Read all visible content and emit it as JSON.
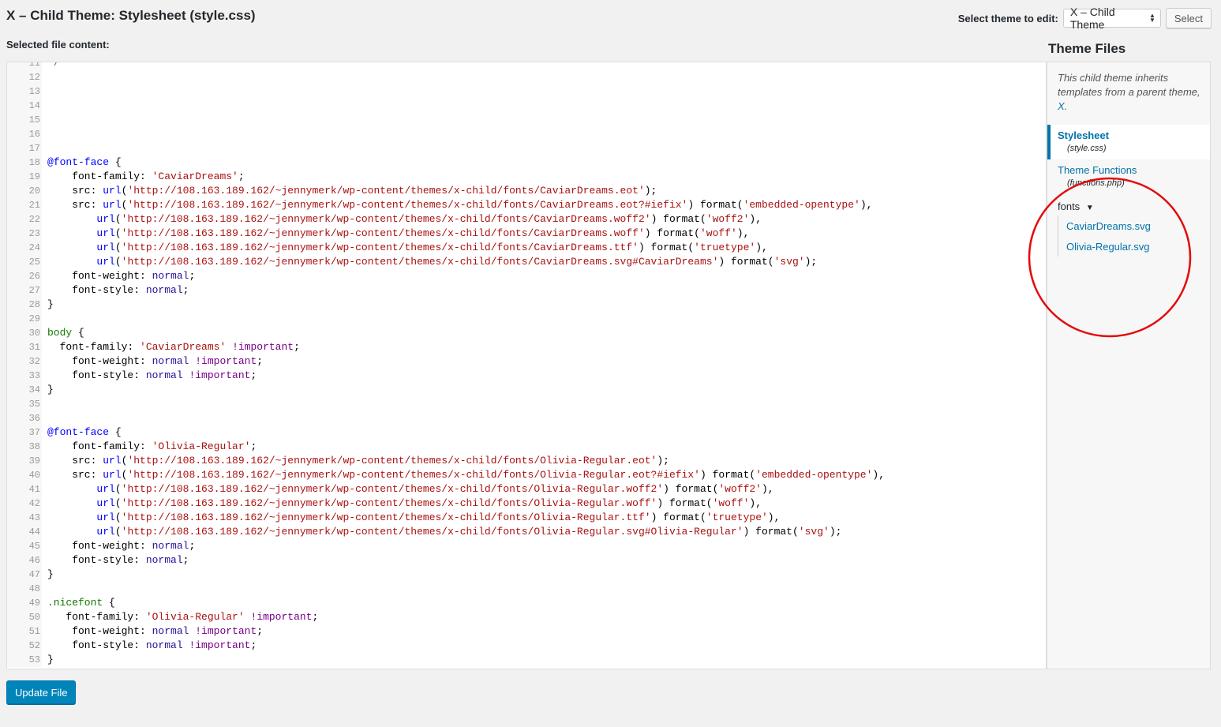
{
  "page_title": "X – Child Theme: Stylesheet (style.css)",
  "theme_selector": {
    "label": "Select theme to edit:",
    "selected": "X – Child Theme",
    "button": "Select"
  },
  "content_label": "Selected file content:",
  "editor": {
    "lines": [
      {
        "n": "11",
        "t": [
          [
            "cmt",
            "*/"
          ]
        ]
      },
      {
        "n": "12",
        "t": []
      },
      {
        "n": "13",
        "t": []
      },
      {
        "n": "14",
        "t": []
      },
      {
        "n": "15",
        "t": []
      },
      {
        "n": "16",
        "t": []
      },
      {
        "n": "17",
        "t": []
      },
      {
        "n": "18",
        "t": [
          [
            "at",
            "@font-face"
          ],
          [
            "",
            " {"
          ]
        ]
      },
      {
        "n": "19",
        "t": [
          [
            "",
            "    font-family: "
          ],
          [
            "str",
            "'CaviarDreams'"
          ],
          [
            "",
            ";"
          ]
        ]
      },
      {
        "n": "20",
        "t": [
          [
            "",
            "    src: "
          ],
          [
            "at",
            "url"
          ],
          [
            "",
            "("
          ],
          [
            "str",
            "'http://108.163.189.162/~jennymerk/wp-content/themes/x-child/fonts/CaviarDreams.eot'"
          ],
          [
            "",
            ");"
          ]
        ]
      },
      {
        "n": "21",
        "t": [
          [
            "",
            "    src: "
          ],
          [
            "at",
            "url"
          ],
          [
            "",
            "("
          ],
          [
            "str",
            "'http://108.163.189.162/~jennymerk/wp-content/themes/x-child/fonts/CaviarDreams.eot?#iefix'"
          ],
          [
            "",
            ") format("
          ],
          [
            "str",
            "'embedded-opentype'"
          ],
          [
            "",
            "),"
          ]
        ]
      },
      {
        "n": "22",
        "t": [
          [
            "",
            "        "
          ],
          [
            "at",
            "url"
          ],
          [
            "",
            "("
          ],
          [
            "str",
            "'http://108.163.189.162/~jennymerk/wp-content/themes/x-child/fonts/CaviarDreams.woff2'"
          ],
          [
            "",
            ") format("
          ],
          [
            "str",
            "'woff2'"
          ],
          [
            "",
            "),"
          ]
        ]
      },
      {
        "n": "23",
        "t": [
          [
            "",
            "        "
          ],
          [
            "at",
            "url"
          ],
          [
            "",
            "("
          ],
          [
            "str",
            "'http://108.163.189.162/~jennymerk/wp-content/themes/x-child/fonts/CaviarDreams.woff'"
          ],
          [
            "",
            ") format("
          ],
          [
            "str",
            "'woff'"
          ],
          [
            "",
            "),"
          ]
        ]
      },
      {
        "n": "24",
        "t": [
          [
            "",
            "        "
          ],
          [
            "at",
            "url"
          ],
          [
            "",
            "("
          ],
          [
            "str",
            "'http://108.163.189.162/~jennymerk/wp-content/themes/x-child/fonts/CaviarDreams.ttf'"
          ],
          [
            "",
            ") format("
          ],
          [
            "str",
            "'truetype'"
          ],
          [
            "",
            "),"
          ]
        ]
      },
      {
        "n": "25",
        "t": [
          [
            "",
            "        "
          ],
          [
            "at",
            "url"
          ],
          [
            "",
            "("
          ],
          [
            "str",
            "'http://108.163.189.162/~jennymerk/wp-content/themes/x-child/fonts/CaviarDreams.svg#CaviarDreams'"
          ],
          [
            "",
            ") format("
          ],
          [
            "str",
            "'svg'"
          ],
          [
            "",
            ");"
          ]
        ]
      },
      {
        "n": "26",
        "t": [
          [
            "",
            "    font-weight: "
          ],
          [
            "kw",
            "normal"
          ],
          [
            "",
            ";"
          ]
        ]
      },
      {
        "n": "27",
        "t": [
          [
            "",
            "    font-style: "
          ],
          [
            "kw",
            "normal"
          ],
          [
            "",
            ";"
          ]
        ]
      },
      {
        "n": "28",
        "t": [
          [
            "",
            "}"
          ]
        ]
      },
      {
        "n": "29",
        "t": []
      },
      {
        "n": "30",
        "t": [
          [
            "sel",
            "body"
          ],
          [
            "",
            " {"
          ]
        ]
      },
      {
        "n": "31",
        "t": [
          [
            "",
            "  font-family: "
          ],
          [
            "str",
            "'CaviarDreams'"
          ],
          [
            "",
            " "
          ],
          [
            "imp",
            "!important"
          ],
          [
            "",
            ";"
          ]
        ]
      },
      {
        "n": "32",
        "t": [
          [
            "",
            "    font-weight: "
          ],
          [
            "kw",
            "normal"
          ],
          [
            "",
            " "
          ],
          [
            "imp",
            "!important"
          ],
          [
            "",
            ";"
          ]
        ]
      },
      {
        "n": "33",
        "t": [
          [
            "",
            "    font-style: "
          ],
          [
            "kw",
            "normal"
          ],
          [
            "",
            " "
          ],
          [
            "imp",
            "!important"
          ],
          [
            "",
            ";"
          ]
        ]
      },
      {
        "n": "34",
        "t": [
          [
            "",
            "}"
          ]
        ]
      },
      {
        "n": "35",
        "t": []
      },
      {
        "n": "36",
        "t": []
      },
      {
        "n": "37",
        "t": [
          [
            "at",
            "@font-face"
          ],
          [
            "",
            " {"
          ]
        ]
      },
      {
        "n": "38",
        "t": [
          [
            "",
            "    font-family: "
          ],
          [
            "str",
            "'Olivia-Regular'"
          ],
          [
            "",
            ";"
          ]
        ]
      },
      {
        "n": "39",
        "t": [
          [
            "",
            "    src: "
          ],
          [
            "at",
            "url"
          ],
          [
            "",
            "("
          ],
          [
            "str",
            "'http://108.163.189.162/~jennymerk/wp-content/themes/x-child/fonts/Olivia-Regular.eot'"
          ],
          [
            "",
            ");"
          ]
        ]
      },
      {
        "n": "40",
        "t": [
          [
            "",
            "    src: "
          ],
          [
            "at",
            "url"
          ],
          [
            "",
            "("
          ],
          [
            "str",
            "'http://108.163.189.162/~jennymerk/wp-content/themes/x-child/fonts/Olivia-Regular.eot?#iefix'"
          ],
          [
            "",
            ") format("
          ],
          [
            "str",
            "'embedded-opentype'"
          ],
          [
            "",
            "),"
          ]
        ]
      },
      {
        "n": "41",
        "t": [
          [
            "",
            "        "
          ],
          [
            "at",
            "url"
          ],
          [
            "",
            "("
          ],
          [
            "str",
            "'http://108.163.189.162/~jennymerk/wp-content/themes/x-child/fonts/Olivia-Regular.woff2'"
          ],
          [
            "",
            ") format("
          ],
          [
            "str",
            "'woff2'"
          ],
          [
            "",
            "),"
          ]
        ]
      },
      {
        "n": "42",
        "t": [
          [
            "",
            "        "
          ],
          [
            "at",
            "url"
          ],
          [
            "",
            "("
          ],
          [
            "str",
            "'http://108.163.189.162/~jennymerk/wp-content/themes/x-child/fonts/Olivia-Regular.woff'"
          ],
          [
            "",
            ") format("
          ],
          [
            "str",
            "'woff'"
          ],
          [
            "",
            "),"
          ]
        ]
      },
      {
        "n": "43",
        "t": [
          [
            "",
            "        "
          ],
          [
            "at",
            "url"
          ],
          [
            "",
            "("
          ],
          [
            "str",
            "'http://108.163.189.162/~jennymerk/wp-content/themes/x-child/fonts/Olivia-Regular.ttf'"
          ],
          [
            "",
            ") format("
          ],
          [
            "str",
            "'truetype'"
          ],
          [
            "",
            "),"
          ]
        ]
      },
      {
        "n": "44",
        "t": [
          [
            "",
            "        "
          ],
          [
            "at",
            "url"
          ],
          [
            "",
            "("
          ],
          [
            "str",
            "'http://108.163.189.162/~jennymerk/wp-content/themes/x-child/fonts/Olivia-Regular.svg#Olivia-Regular'"
          ],
          [
            "",
            ") format("
          ],
          [
            "str",
            "'svg'"
          ],
          [
            "",
            ");"
          ]
        ]
      },
      {
        "n": "45",
        "t": [
          [
            "",
            "    font-weight: "
          ],
          [
            "kw",
            "normal"
          ],
          [
            "",
            ";"
          ]
        ]
      },
      {
        "n": "46",
        "t": [
          [
            "",
            "    font-style: "
          ],
          [
            "kw",
            "normal"
          ],
          [
            "",
            ";"
          ]
        ]
      },
      {
        "n": "47",
        "t": [
          [
            "",
            "}"
          ]
        ]
      },
      {
        "n": "48",
        "t": []
      },
      {
        "n": "49",
        "t": [
          [
            "sel",
            ".nicefont"
          ],
          [
            "",
            " {"
          ]
        ]
      },
      {
        "n": "50",
        "t": [
          [
            "",
            "   font-family: "
          ],
          [
            "str",
            "'Olivia-Regular'"
          ],
          [
            "",
            " "
          ],
          [
            "imp",
            "!important"
          ],
          [
            "",
            ";"
          ]
        ]
      },
      {
        "n": "51",
        "t": [
          [
            "",
            "    font-weight: "
          ],
          [
            "kw",
            "normal"
          ],
          [
            "",
            " "
          ],
          [
            "imp",
            "!important"
          ],
          [
            "",
            ";"
          ]
        ]
      },
      {
        "n": "52",
        "t": [
          [
            "",
            "    font-style: "
          ],
          [
            "kw",
            "normal"
          ],
          [
            "",
            " "
          ],
          [
            "imp",
            "!important"
          ],
          [
            "",
            ";"
          ]
        ]
      },
      {
        "n": "53",
        "t": [
          [
            "",
            "}"
          ]
        ]
      }
    ]
  },
  "sidebar": {
    "heading": "Theme Files",
    "note_prefix": "This child theme inherits templates from a parent theme, ",
    "note_link": "X",
    "note_suffix": ".",
    "files": [
      {
        "title": "Stylesheet",
        "sub": "(style.css)",
        "active": true
      },
      {
        "title": "Theme Functions",
        "sub": "(functions.php)",
        "active": false
      }
    ],
    "folder": {
      "name": "fonts",
      "arrow_icon": "caret-down-icon",
      "files": [
        "CaviarDreams.svg",
        "Olivia-Regular.svg"
      ]
    }
  },
  "update_button": "Update File",
  "colors": {
    "accent": "#0073aa",
    "primary_button": "#0085ba",
    "annotation": "#e30b0b"
  }
}
